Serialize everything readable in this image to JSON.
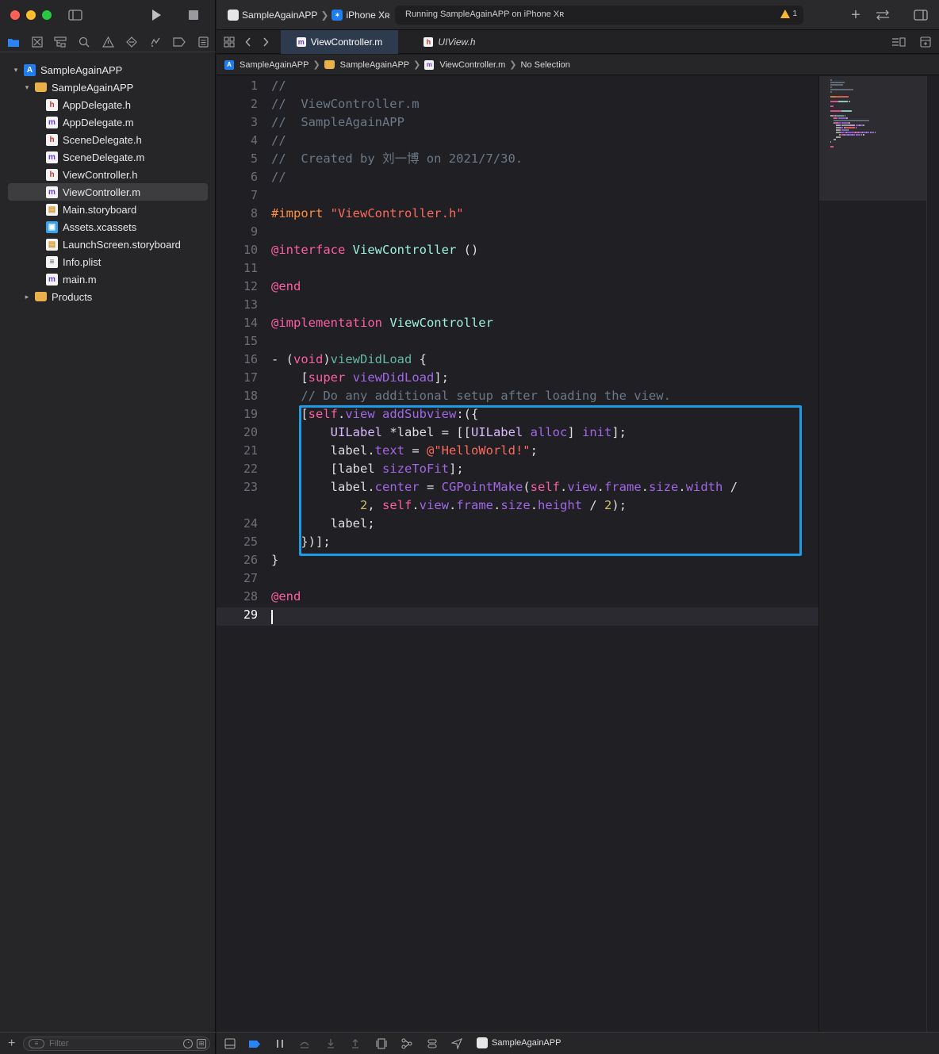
{
  "window": {
    "scheme_app": "SampleAgainAPP",
    "scheme_device": "iPhone Xʀ",
    "activity_status": "Running SampleAgainAPP on iPhone Xʀ",
    "warning_count": "1"
  },
  "navigator": {
    "tabs": [
      "folder-icon",
      "source-control-icon",
      "symbol-icon",
      "search-icon",
      "issue-icon",
      "test-icon",
      "debug-icon",
      "breakpoint-icon",
      "report-icon"
    ],
    "tree": [
      {
        "label": "SampleAgainAPP",
        "kind": "project",
        "indent": 0,
        "disclosure": "▾"
      },
      {
        "label": "SampleAgainAPP",
        "kind": "folder",
        "indent": 1,
        "disclosure": "▾"
      },
      {
        "label": "AppDelegate.h",
        "kind": "h",
        "indent": 2
      },
      {
        "label": "AppDelegate.m",
        "kind": "m",
        "indent": 2
      },
      {
        "label": "SceneDelegate.h",
        "kind": "h",
        "indent": 2
      },
      {
        "label": "SceneDelegate.m",
        "kind": "m",
        "indent": 2
      },
      {
        "label": "ViewController.h",
        "kind": "h",
        "indent": 2
      },
      {
        "label": "ViewController.m",
        "kind": "m",
        "indent": 2,
        "selected": true
      },
      {
        "label": "Main.storyboard",
        "kind": "storyboard",
        "indent": 2
      },
      {
        "label": "Assets.xcassets",
        "kind": "assets",
        "indent": 2
      },
      {
        "label": "LaunchScreen.storyboard",
        "kind": "storyboard",
        "indent": 2
      },
      {
        "label": "Info.plist",
        "kind": "plist",
        "indent": 2
      },
      {
        "label": "main.m",
        "kind": "m",
        "indent": 2
      },
      {
        "label": "Products",
        "kind": "folder",
        "indent": 1,
        "disclosure": "▸"
      }
    ],
    "filter_placeholder": "Filter"
  },
  "tabs": {
    "active": "ViewController.m",
    "inactive": "UIView.h"
  },
  "jumpbar": {
    "project": "SampleAgainAPP",
    "group": "SampleAgainAPP",
    "file": "ViewController.m",
    "selection": "No Selection"
  },
  "editor": {
    "current_line": "29",
    "lines": [
      {
        "n": "1",
        "segs": [
          [
            "c-com",
            "//"
          ]
        ]
      },
      {
        "n": "2",
        "segs": [
          [
            "c-com",
            "//  ViewController.m"
          ]
        ]
      },
      {
        "n": "3",
        "segs": [
          [
            "c-com",
            "//  SampleAgainAPP"
          ]
        ]
      },
      {
        "n": "4",
        "segs": [
          [
            "c-com",
            "//"
          ]
        ]
      },
      {
        "n": "5",
        "segs": [
          [
            "c-com",
            "//  Created by 刘一博 on 2021/7/30."
          ]
        ]
      },
      {
        "n": "6",
        "segs": [
          [
            "c-com",
            "//"
          ]
        ]
      },
      {
        "n": "7",
        "segs": []
      },
      {
        "n": "8",
        "segs": [
          [
            "c-pre",
            "#import "
          ],
          [
            "c-str",
            "\"ViewController.h\""
          ]
        ]
      },
      {
        "n": "9",
        "segs": []
      },
      {
        "n": "10",
        "segs": [
          [
            "c-kw2",
            "@interface "
          ],
          [
            "c-cls",
            "ViewController"
          ],
          [
            "",
            " ()"
          ]
        ]
      },
      {
        "n": "11",
        "segs": []
      },
      {
        "n": "12",
        "segs": [
          [
            "c-kw2",
            "@end"
          ]
        ]
      },
      {
        "n": "13",
        "segs": []
      },
      {
        "n": "14",
        "segs": [
          [
            "c-kw2",
            "@implementation "
          ],
          [
            "c-cls",
            "ViewController"
          ]
        ]
      },
      {
        "n": "15",
        "segs": []
      },
      {
        "n": "16",
        "segs": [
          [
            "",
            "- ("
          ],
          [
            "c-kw2",
            "void"
          ],
          [
            "",
            ")"
          ],
          [
            "c-fn",
            "viewDidLoad"
          ],
          [
            "",
            " {"
          ]
        ]
      },
      {
        "n": "17",
        "segs": [
          [
            "",
            "    ["
          ],
          [
            "c-kw2",
            "super"
          ],
          [
            "",
            " "
          ],
          [
            "c-met",
            "viewDidLoad"
          ],
          [
            "",
            "];"
          ]
        ]
      },
      {
        "n": "18",
        "segs": [
          [
            "c-com",
            "    // Do any additional setup after loading the view."
          ]
        ]
      },
      {
        "n": "19",
        "segs": [
          [
            "",
            "    ["
          ],
          [
            "c-kw2",
            "self"
          ],
          [
            "",
            "."
          ],
          [
            "c-met",
            "view"
          ],
          [
            "",
            " "
          ],
          [
            "c-met",
            "addSubview"
          ],
          [
            "",
            ":({"
          ]
        ]
      },
      {
        "n": "20",
        "segs": [
          [
            "",
            "        "
          ],
          [
            "c-typ",
            "UILabel"
          ],
          [
            "",
            " *label = [["
          ],
          [
            "c-typ",
            "UILabel"
          ],
          [
            "",
            " "
          ],
          [
            "c-met",
            "alloc"
          ],
          [
            "",
            "] "
          ],
          [
            "c-met",
            "init"
          ],
          [
            "",
            "];"
          ]
        ]
      },
      {
        "n": "21",
        "segs": [
          [
            "",
            "        label."
          ],
          [
            "c-met",
            "text"
          ],
          [
            "",
            " = "
          ],
          [
            "c-str",
            "@\"HelloWorld!\""
          ],
          [
            "",
            ";"
          ]
        ]
      },
      {
        "n": "22",
        "segs": [
          [
            "",
            "        [label "
          ],
          [
            "c-met",
            "sizeToFit"
          ],
          [
            "",
            "];"
          ]
        ]
      },
      {
        "n": "23",
        "segs": [
          [
            "",
            "        label."
          ],
          [
            "c-met",
            "center"
          ],
          [
            "",
            " = "
          ],
          [
            "c-met",
            "CGPointMake"
          ],
          [
            "",
            "("
          ],
          [
            "c-kw2",
            "self"
          ],
          [
            "",
            "."
          ],
          [
            "c-met",
            "view"
          ],
          [
            "",
            "."
          ],
          [
            "c-met",
            "frame"
          ],
          [
            "",
            "."
          ],
          [
            "c-met",
            "size"
          ],
          [
            "",
            "."
          ],
          [
            "c-met",
            "width"
          ],
          [
            "",
            " /"
          ]
        ]
      },
      {
        "n": "",
        "segs": [
          [
            "",
            "            "
          ],
          [
            "c-num",
            "2"
          ],
          [
            "",
            ", "
          ],
          [
            "c-kw2",
            "self"
          ],
          [
            "",
            "."
          ],
          [
            "c-met",
            "view"
          ],
          [
            "",
            "."
          ],
          [
            "c-met",
            "frame"
          ],
          [
            "",
            "."
          ],
          [
            "c-met",
            "size"
          ],
          [
            "",
            "."
          ],
          [
            "c-met",
            "height"
          ],
          [
            "",
            " / "
          ],
          [
            "c-num",
            "2"
          ],
          [
            "",
            ");"
          ]
        ]
      },
      {
        "n": "24",
        "segs": [
          [
            "",
            "        label;"
          ]
        ]
      },
      {
        "n": "25",
        "segs": [
          [
            "",
            "    })];"
          ]
        ]
      },
      {
        "n": "26",
        "segs": [
          [
            "",
            "}"
          ]
        ]
      },
      {
        "n": "27",
        "segs": []
      },
      {
        "n": "28",
        "segs": [
          [
            "c-kw2",
            "@end"
          ]
        ]
      },
      {
        "n": "29",
        "segs": []
      }
    ]
  },
  "debugbar": {
    "target": "SampleAgainAPP"
  },
  "colors": {
    "highlight_box": "#1e9be6",
    "selection": "#3d3d40",
    "active_tab": "#2e3a4d"
  }
}
